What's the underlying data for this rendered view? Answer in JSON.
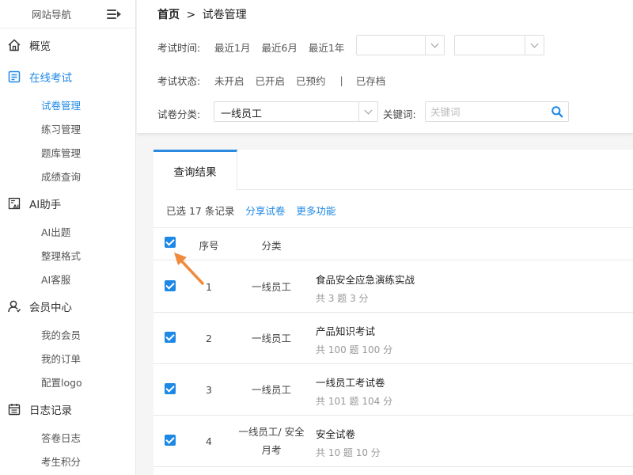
{
  "sidebar": {
    "title": "网站导航",
    "groups": [
      {
        "label": "概览",
        "icon": "home-icon",
        "items": []
      },
      {
        "label": "在线考试",
        "icon": "exam-icon",
        "items": [
          "试卷管理",
          "练习管理",
          "题库管理",
          "成绩查询"
        ]
      },
      {
        "label": "AI助手",
        "icon": "ai-icon",
        "items": [
          "AI出题",
          "整理格式",
          "AI客服"
        ]
      },
      {
        "label": "会员中心",
        "icon": "user-icon",
        "items": [
          "我的会员",
          "我的订单",
          "配置logo"
        ]
      },
      {
        "label": "日志记录",
        "icon": "calendar-icon",
        "items": [
          "答卷日志",
          "考生积分"
        ]
      }
    ]
  },
  "breadcrumb": {
    "home": "首页",
    "separator": ">",
    "current": "试卷管理"
  },
  "filters": {
    "time_label": "考试时间:",
    "time_options": [
      "最近1月",
      "最近6月",
      "最近1年"
    ],
    "status_label": "考试状态:",
    "status_options": [
      "未开启",
      "已开启",
      "已预约"
    ],
    "status_separator": "|",
    "status_archived": "已存档",
    "category_label": "试卷分类:",
    "category_value": "一线员工",
    "keyword_label": "关键词:",
    "keyword_placeholder": "关键词"
  },
  "results": {
    "tab": "查询结果",
    "selected_text": "已选 17 条记录",
    "share": "分享试卷",
    "more": "更多功能",
    "headers": {
      "no": "序号",
      "category": "分类"
    },
    "rows": [
      {
        "no": "1",
        "category": "一线员工",
        "title": "食品安全应急演练实战",
        "meta": "共 3 题 3 分"
      },
      {
        "no": "2",
        "category": "一线员工",
        "title": "产品知识考试",
        "meta": "共 100 题 100 分"
      },
      {
        "no": "3",
        "category": "一线员工",
        "title": "一线员工考试卷",
        "meta": "共 101 题 104 分"
      },
      {
        "no": "4",
        "category": "一线员工/ 安全月考",
        "title": "安全试卷",
        "meta": "共 10 题 10 分"
      }
    ]
  },
  "colors": {
    "accent": "#1e88e5",
    "pointer": "#f08a3c"
  }
}
